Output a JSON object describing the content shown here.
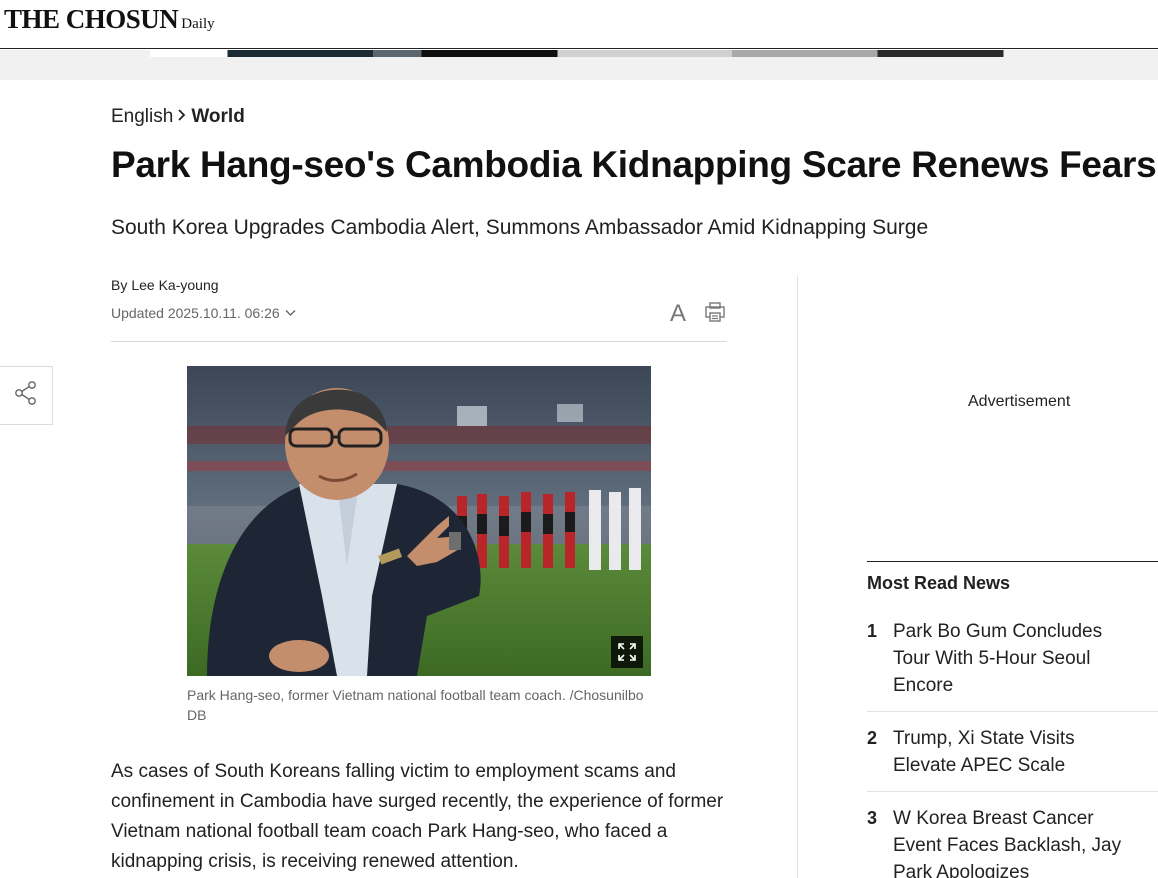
{
  "header": {
    "logo_main": "THE CHOSUN",
    "logo_sub": "Daily"
  },
  "breadcrumb": {
    "section": "English",
    "current": "World"
  },
  "article": {
    "headline": "Park Hang-seo's Cambodia Kidnapping Scare Renews Fears",
    "subheadline": "South Korea Upgrades Cambodia Alert, Summons Ambassador Amid Kidnapping Surge",
    "by_label": "By",
    "author": "Lee Ka-young",
    "updated": "Updated 2025.10.11. 06:26",
    "font_size_icon_label": "A",
    "photo_caption": "Park Hang-seo, former Vietnam national football team coach. /Chosunilbo DB",
    "body_paragraph": "As cases of South Koreans falling victim to employment scams and confinement in Cambodia have surged recently, the experience of former Vietnam national football team coach Park Hang-seo, who faced a kidnapping crisis, is receiving renewed attention."
  },
  "sidebar": {
    "ad_label": "Advertisement",
    "most_read_title": "Most Read News",
    "most_read": [
      {
        "rank": "1",
        "title": "Park Bo Gum Concludes Tour With 5-Hour Seoul Encore"
      },
      {
        "rank": "2",
        "title": "Trump, Xi State Visits Elevate APEC Scale"
      },
      {
        "rank": "3",
        "title": "W Korea Breast Cancer Event Faces Backlash, Jay Park Apologizes"
      }
    ]
  },
  "icons": {
    "share": "share-icon",
    "font_size": "font-size-icon",
    "print": "print-icon",
    "expand": "expand-icon",
    "dropdown": "chevron-down-icon"
  }
}
